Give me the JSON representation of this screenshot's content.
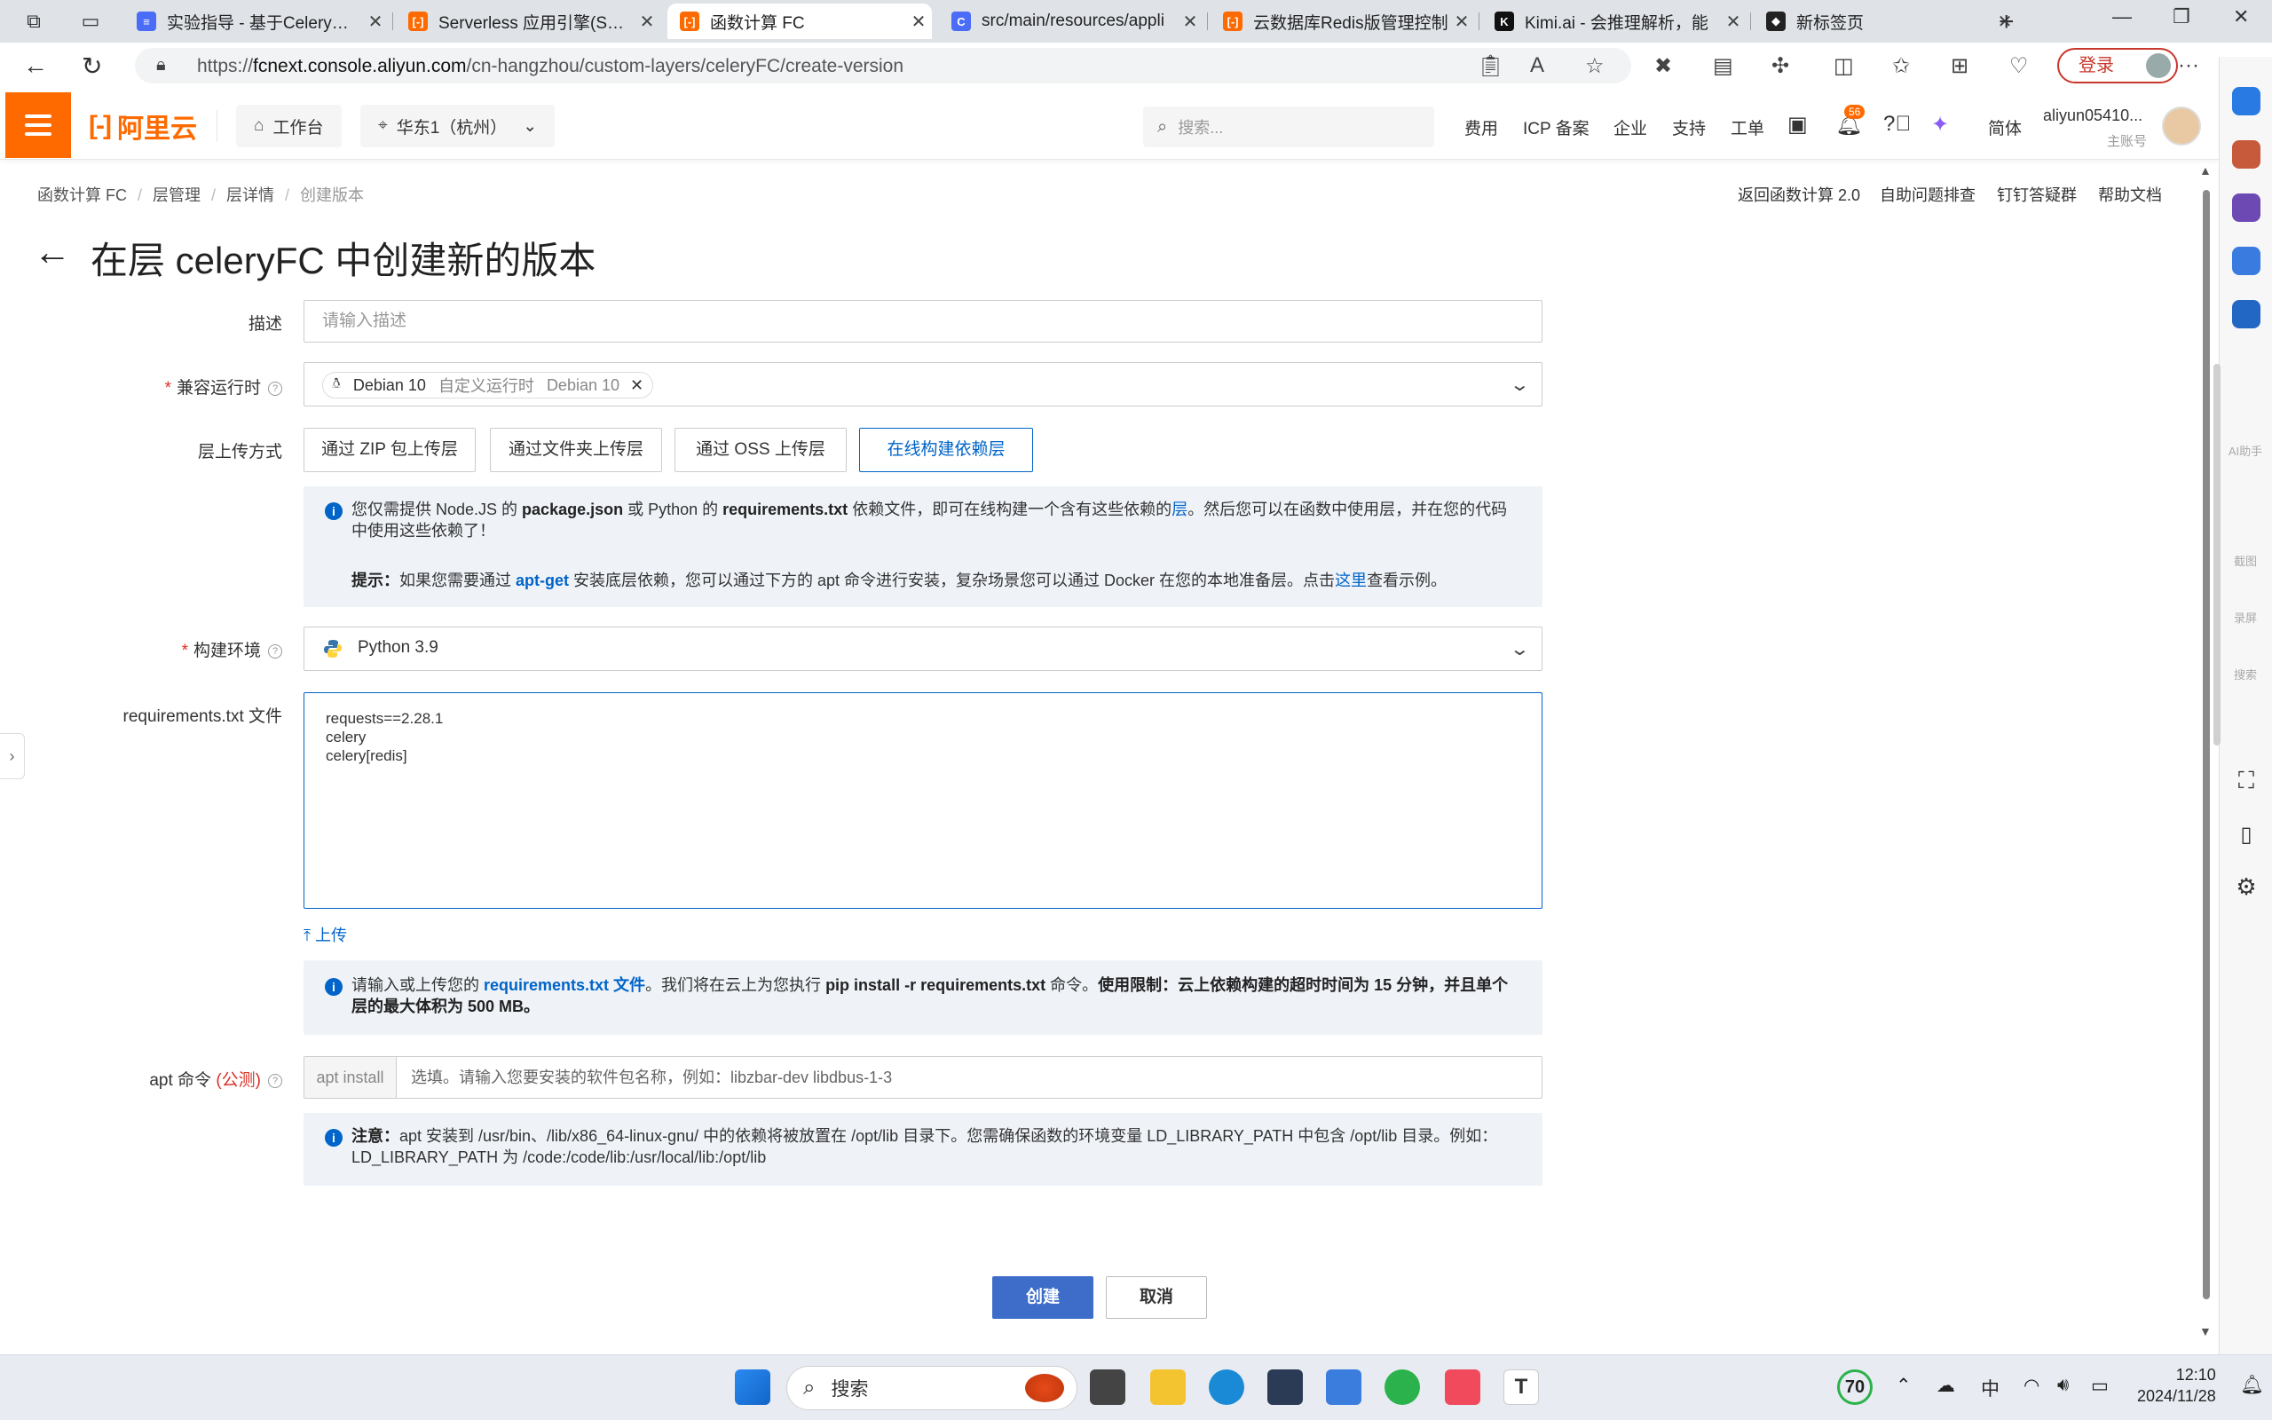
{
  "browser": {
    "tabs": [
      {
        "title": "实验指导 - 基于Celery实现",
        "color": "#4a6cf7",
        "glyph": "≡"
      },
      {
        "title": "Serverless 应用引擎(SAE)",
        "color": "#ff6a00",
        "glyph": "[-]"
      },
      {
        "title": "函数计算 FC",
        "color": "#ff6a00",
        "glyph": "[-]"
      },
      {
        "title": "src/main/resources/appli",
        "color": "#4a6cf7",
        "glyph": "C"
      },
      {
        "title": "云数据库Redis版管理控制",
        "color": "#ff6a00",
        "glyph": "[-]"
      },
      {
        "title": "Kimi.ai - 会推理解析，能",
        "color": "#111111",
        "glyph": "K"
      },
      {
        "title": "新标签页",
        "color": "#222222",
        "glyph": "◆"
      }
    ],
    "active_tab": 2,
    "url_prefix": "https://",
    "url_host": "fcnext.console.aliyun.com",
    "url_path": "/cn-hangzhou/custom-layers/celeryFC/create-version",
    "login_label": "登录"
  },
  "header": {
    "logo_text": "阿里云",
    "workbench": "工作台",
    "region": "华东1（杭州）",
    "search_placeholder": "搜索...",
    "links": [
      "费用",
      "ICP 备案",
      "企业",
      "支持",
      "工单"
    ],
    "notification_count": "56",
    "lang": "简体",
    "user_name": "aliyun05410...",
    "user_sub": "主账号"
  },
  "breadcrumb": [
    "函数计算 FC",
    "层管理",
    "层详情",
    "创建版本"
  ],
  "top_links": [
    "返回函数计算 2.0",
    "自助问题排查",
    "钉钉答疑群",
    "帮助文档"
  ],
  "page_title": "在层 celeryFC 中创建新的版本",
  "form": {
    "desc_label": "描述",
    "desc_placeholder": "请输入描述",
    "runtime_label": "兼容运行时",
    "runtime_tag": {
      "name": "Debian 10",
      "kind": "自定义运行时",
      "ver": "Debian 10"
    },
    "upload_label": "层上传方式",
    "upload_methods": [
      "通过 ZIP 包上传层",
      "通过文件夹上传层",
      "通过 OSS 上传层",
      "在线构建依赖层"
    ],
    "upload_selected": 3,
    "info1_a": "您仅需提供 Node.JS 的 ",
    "info1_b": "package.json",
    "info1_c": " 或 Python 的 ",
    "info1_d": "requirements.txt",
    "info1_e": " 依赖文件，即可在线构建一个含有这些依赖的",
    "info1_f": "层",
    "info1_g": "。然后您可以在函数中使用层，并在您的代码中使用这些依赖了！",
    "tip_a": "提示：",
    "tip_b": "如果您需要通过 ",
    "tip_c": "apt-get",
    "tip_d": " 安装底层依赖，您可以通过下方的 apt 命令进行安装，复杂场景您可以通过 Docker 在您的本地准备层。点击",
    "tip_e": "这里",
    "tip_f": "查看示例。",
    "env_label": "构建环境",
    "env_value": "Python 3.9",
    "req_label": "requirements.txt 文件",
    "req_content": "requests==2.28.1\ncelery\ncelery[redis]",
    "upload_link": "上传",
    "info2_a": "请输入或上传您的 ",
    "info2_b": "requirements.txt 文件",
    "info2_c": "。我们将在云上为您执行 ",
    "info2_d": "pip install -r requirements.txt",
    "info2_e": " 命令。",
    "info2_f": "使用限制：云上依赖构建的超时时间为 15 分钟，并且单个层的最大体积为 500 MB。",
    "apt_label": "apt 命令",
    "apt_beta": "(公测)",
    "apt_prefix": "apt install",
    "apt_placeholder": "选填。请输入您要安装的软件包名称，例如：libzbar-dev libdbus-1-3",
    "note_a": "注意：",
    "note_b": "apt 安装到 /usr/bin、/lib/x86_64-linux-gnu/ 中的依赖将被放置在 /opt/lib 目录下。您需确保函数的环境变量 LD_LIBRARY_PATH 中包含 /opt/lib 目录。例如：LD_LIBRARY_PATH 为 /code:/code/lib:/usr/local/lib:/opt/lib",
    "create": "创建",
    "cancel": "取消"
  },
  "edge_labels": [
    "AI助手",
    "截图",
    "录屏",
    "搜索"
  ],
  "taskbar": {
    "search": "搜索",
    "weather": "70",
    "ime": "中",
    "time": "12:10",
    "date": "2024/11/28"
  }
}
